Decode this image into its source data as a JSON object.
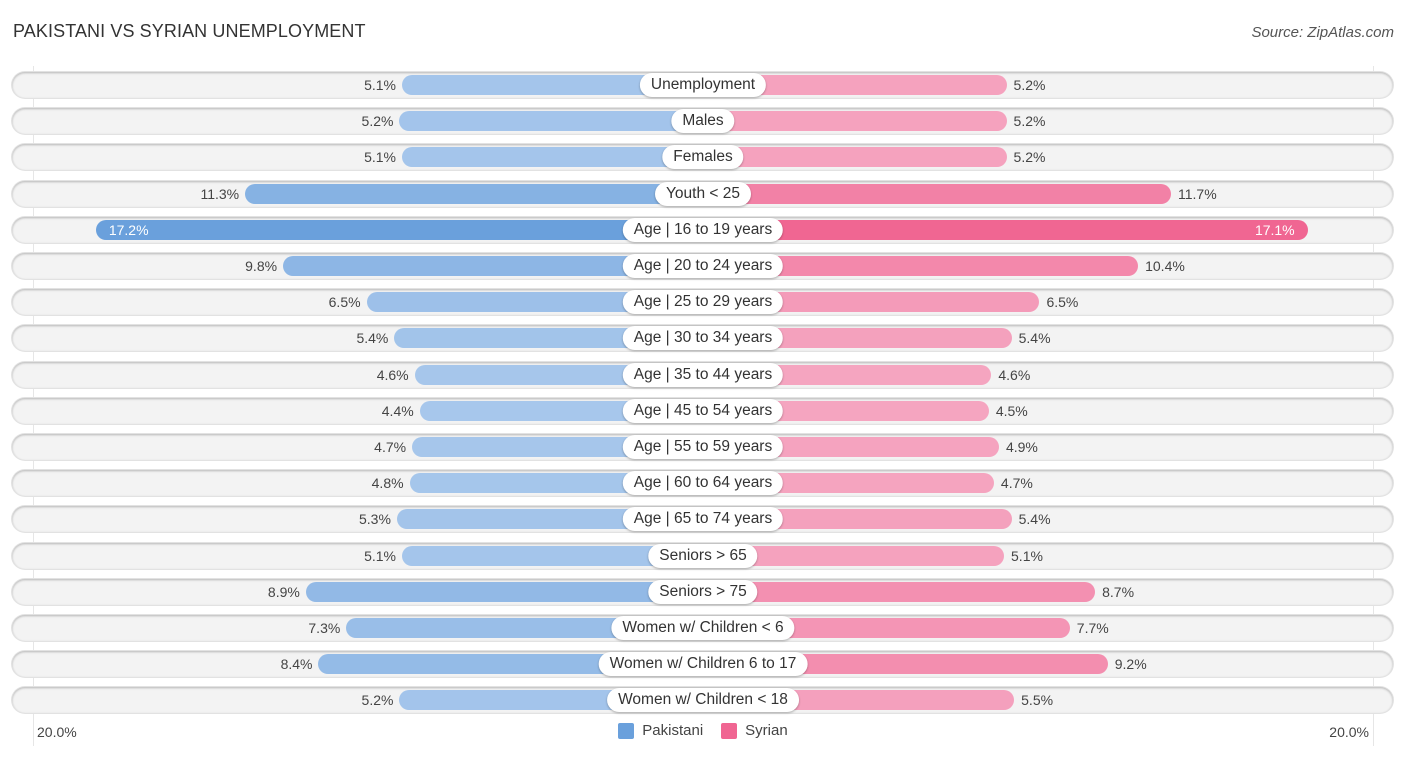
{
  "header": {
    "title": "PAKISTANI VS SYRIAN UNEMPLOYMENT",
    "source": "Source: ZipAtlas.com"
  },
  "colors": {
    "pakistani_strong": "#6aa0dc",
    "pakistani_light": "#a9c8ec",
    "syrian_strong": "#f06592",
    "syrian_light": "#f5a8c2"
  },
  "chart_data": {
    "type": "bar",
    "orientation": "horizontal-diverging",
    "title": "PAKISTANI VS SYRIAN UNEMPLOYMENT",
    "categories": [
      "Unemployment",
      "Males",
      "Females",
      "Youth < 25",
      "Age | 16 to 19 years",
      "Age | 20 to 24 years",
      "Age | 25 to 29 years",
      "Age | 30 to 34 years",
      "Age | 35 to 44 years",
      "Age | 45 to 54 years",
      "Age | 55 to 59 years",
      "Age | 60 to 64 years",
      "Age | 65 to 74 years",
      "Seniors > 65",
      "Seniors > 75",
      "Women w/ Children < 6",
      "Women w/ Children 6 to 17",
      "Women w/ Children < 18"
    ],
    "series": [
      {
        "name": "Pakistani",
        "side": "left",
        "values": [
          5.1,
          5.2,
          5.1,
          11.3,
          17.2,
          9.8,
          6.5,
          5.4,
          4.6,
          4.4,
          4.7,
          4.8,
          5.3,
          5.1,
          8.9,
          7.3,
          8.4,
          5.2
        ]
      },
      {
        "name": "Syrian",
        "side": "right",
        "values": [
          5.2,
          5.2,
          5.2,
          11.7,
          17.1,
          10.4,
          6.5,
          5.4,
          4.6,
          4.5,
          4.9,
          4.7,
          5.4,
          5.1,
          8.7,
          7.7,
          9.2,
          5.5
        ]
      }
    ],
    "value_format": "{v}%",
    "axis": {
      "min_label": "20.0%",
      "max_label": "20.0%",
      "range": [
        0,
        20
      ]
    },
    "legend": {
      "position": "bottom-center",
      "entries": [
        "Pakistani",
        "Syrian"
      ]
    },
    "grid": false
  }
}
